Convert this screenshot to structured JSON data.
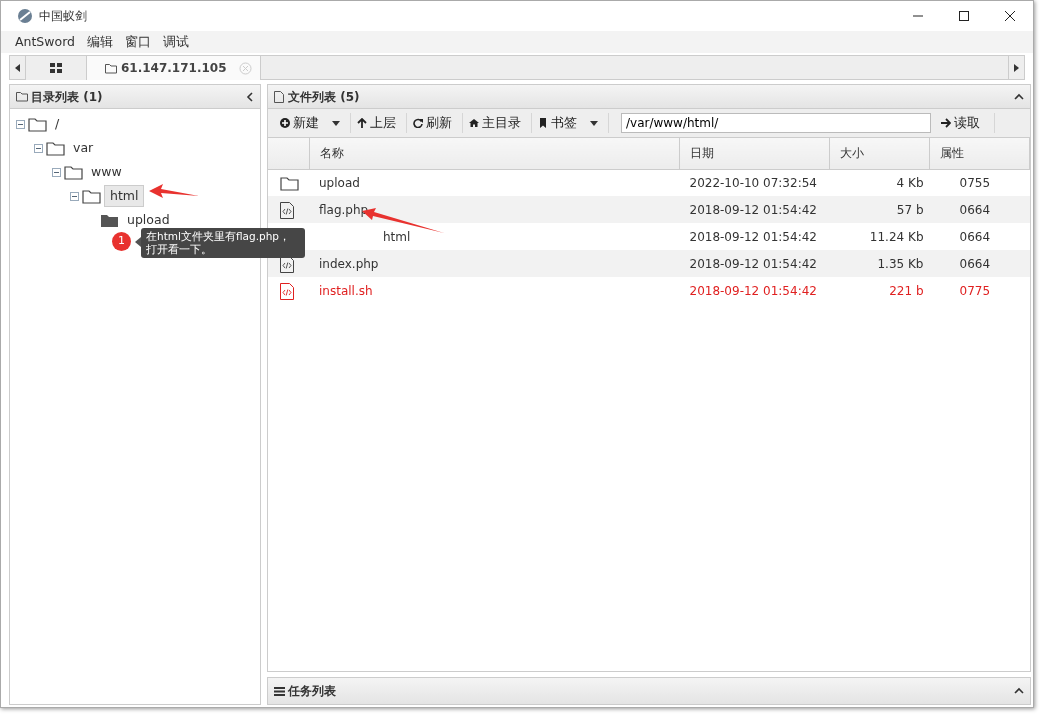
{
  "window": {
    "title": "中国蚁剑"
  },
  "menu": [
    "AntSword",
    "编辑",
    "窗口",
    "调试"
  ],
  "tabs": [
    {
      "kind": "home",
      "selected": false
    },
    {
      "kind": "host",
      "label": "61.147.171.105",
      "selected": true
    }
  ],
  "dir_panel": {
    "title": "目录列表 (1)",
    "tree": [
      {
        "label": "/",
        "kind": "expandable",
        "expanded": true,
        "selected": false,
        "children": [
          {
            "label": "var",
            "kind": "expandable",
            "expanded": true,
            "selected": false,
            "children": [
              {
                "label": "www",
                "kind": "expandable",
                "expanded": true,
                "selected": false,
                "children": [
                  {
                    "label": "html",
                    "kind": "expandable",
                    "expanded": true,
                    "selected": true,
                    "children": [
                      {
                        "label": "upload",
                        "kind": "leaf",
                        "selected": false
                      }
                    ]
                  }
                ]
              }
            ]
          }
        ]
      }
    ]
  },
  "file_panel": {
    "title": "文件列表 (5)",
    "toolbar": [
      {
        "kind": "new",
        "label": "新建",
        "dropdown": true
      },
      {
        "kind": "up",
        "label": "上层",
        "dropdown": false
      },
      {
        "kind": "refresh",
        "label": "刷新",
        "dropdown": false
      },
      {
        "kind": "home",
        "label": "主目录",
        "dropdown": false
      },
      {
        "kind": "bookmark",
        "label": "书签",
        "dropdown": true
      }
    ],
    "path": "/var/www/html/",
    "read_button": "读取",
    "columns": [
      "名称",
      "日期",
      "大小",
      "属性"
    ],
    "rows": [
      {
        "kind": "folder",
        "name": "upload",
        "date": "2022-10-10 07:32:54",
        "size": "4 Kb",
        "perm": "0755",
        "warning": false,
        "covered": false
      },
      {
        "kind": "file",
        "name": "flag.php",
        "date": "2018-09-12 01:54:42",
        "size": "57 b",
        "perm": "0664",
        "warning": false,
        "covered": false
      },
      {
        "name": "html",
        "date": "2018-09-12 01:54:42",
        "size": "11.24 Kb",
        "perm": "0664",
        "warning": false,
        "covered": true
      },
      {
        "kind": "file",
        "name": "index.php",
        "date": "2018-09-12 01:54:42",
        "size": "1.35 Kb",
        "perm": "0664",
        "warning": false,
        "covered": false
      },
      {
        "kind": "file",
        "name": "install.sh",
        "date": "2018-09-12 01:54:42",
        "size": "221 b",
        "perm": "0775",
        "warning": true,
        "covered": false
      }
    ]
  },
  "task_panel": {
    "title": "任务列表"
  },
  "annotation": {
    "number": "1",
    "lines": [
      "在html文件夹里有flag.php，",
      "打开看一下。"
    ]
  }
}
